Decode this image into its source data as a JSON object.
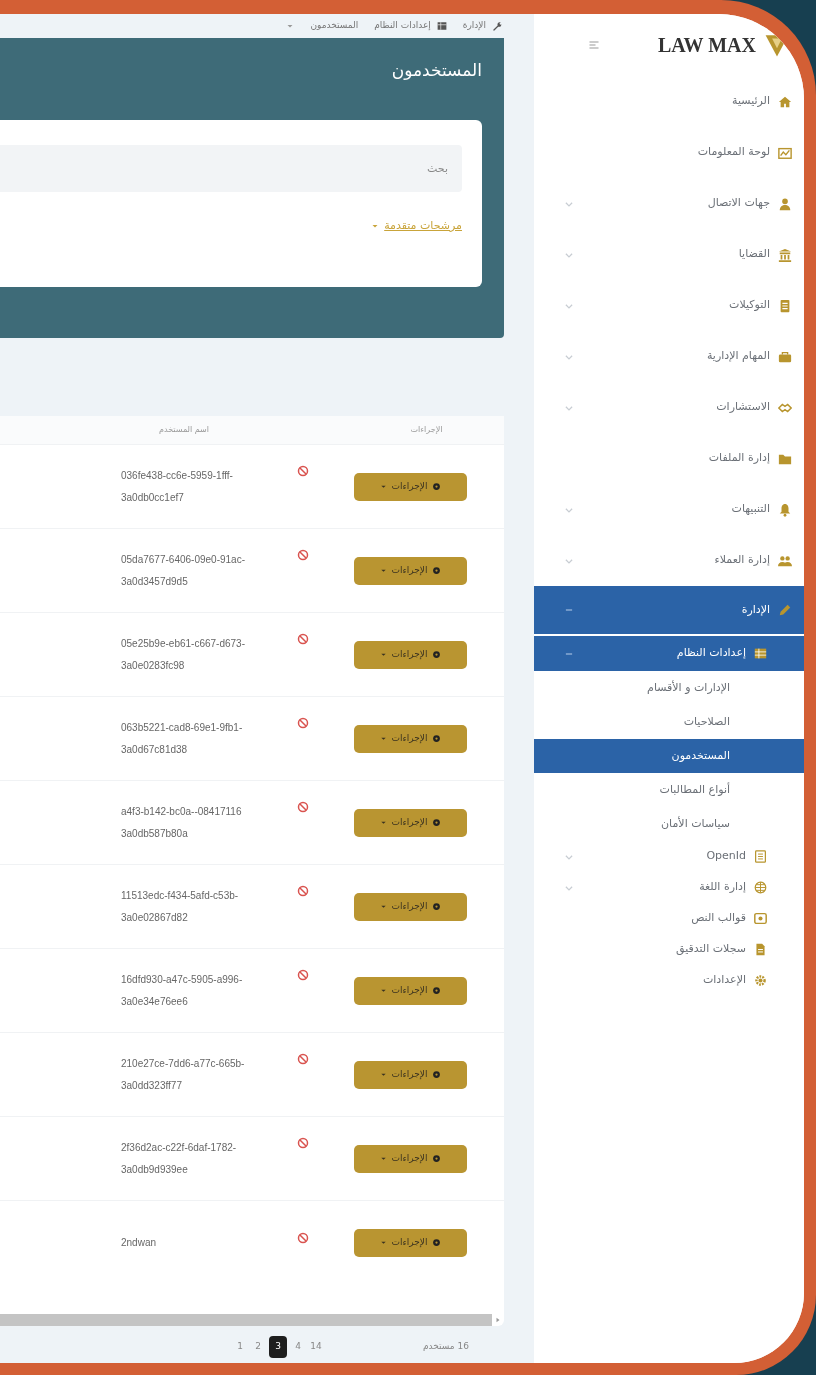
{
  "brand": {
    "name": "LAW MAX"
  },
  "sidebar": {
    "items": [
      {
        "label": "الرئيسية",
        "selected": false
      },
      {
        "label": "لوحة المعلومات",
        "selected": false
      },
      {
        "label": "جهات الاتصال",
        "selected": false,
        "expanded": false
      },
      {
        "label": "القضايا",
        "selected": false,
        "expanded": false
      },
      {
        "label": "التوكيلات",
        "selected": false,
        "expanded": false
      },
      {
        "label": "المهام الإدارية",
        "selected": false,
        "expanded": false
      },
      {
        "label": "الاستشارات",
        "selected": false,
        "expanded": false
      },
      {
        "label": "إدارة الملفات",
        "selected": false
      },
      {
        "label": "التنبيهات",
        "selected": false,
        "expanded": false
      },
      {
        "label": "إدارة العملاء",
        "selected": false,
        "expanded": false
      },
      {
        "label": "الإدارة",
        "selected": true,
        "expanded": true,
        "children": [
          {
            "label": "إعدادات النظام",
            "selected": true,
            "expanded": true,
            "children": [
              {
                "label": "الإدارات و الأقسام",
                "selected": false
              },
              {
                "label": "الصلاحيات",
                "selected": false
              },
              {
                "label": "المستخدمون",
                "selected": true
              },
              {
                "label": "أنواع المطالبات",
                "selected": false
              },
              {
                "label": "سياسات الأمان",
                "selected": false
              }
            ]
          },
          {
            "label": "OpenId",
            "selected": false,
            "expanded": false
          },
          {
            "label": "إدارة اللغة",
            "selected": false,
            "expanded": false
          },
          {
            "label": "قوالب النص",
            "selected": false
          },
          {
            "label": "سجلات التدقيق",
            "selected": false
          },
          {
            "label": "الإعدادات",
            "selected": false
          }
        ]
      }
    ]
  },
  "breadcrumb": [
    "الإدارة",
    "إعدادات النظام",
    "المستخدمون"
  ],
  "page_title": "المستخدمون",
  "search": {
    "placeholder": "بحث"
  },
  "advanced_filters": "مرشحات متقدمة",
  "table": {
    "columns": [
      "الإجراءات",
      "اسم المستخدم"
    ],
    "rows": [
      {
        "action": "الإجراءات",
        "username": "036fe438-cc6e-5959-1fff-3a0db0cc1ef7"
      },
      {
        "action": "الإجراءات",
        "username": "05da7677-6406-09e0-91ac-3a0d3457d9d5"
      },
      {
        "action": "الإجراءات",
        "username": "05e25b9e-eb61-c667-d673-3a0e0283fc98"
      },
      {
        "action": "الإجراءات",
        "username": "063b5221-cad8-69e1-9fb1-3a0d67c81d38"
      },
      {
        "action": "الإجراءات",
        "username": "a4f3-b142-bc0a--08417116 3a0db587b80a"
      },
      {
        "action": "الإجراءات",
        "username": "11513edc-f434-5afd-c53b-3a0e02867d82"
      },
      {
        "action": "الإجراءات",
        "username": "16dfd930-a47c-5905-a996-3a0e34e76ee6"
      },
      {
        "action": "الإجراءات",
        "username": "210e27ce-7dd6-a77c-665b-3a0dd323ff77"
      },
      {
        "action": "الإجراءات",
        "username": "2f36d2ac-c22f-6daf-1782-3a0db9d939ee"
      },
      {
        "action": "الإجراءات",
        "username": "2ndwan"
      }
    ]
  },
  "pagination": {
    "total": "16 مستخدم",
    "pages": [
      {
        "label": "14",
        "selected": false
      },
      {
        "label": "4",
        "selected": false
      },
      {
        "label": "3",
        "selected": true
      },
      {
        "label": "2",
        "selected": false
      },
      {
        "label": "1",
        "selected": false
      }
    ]
  }
}
